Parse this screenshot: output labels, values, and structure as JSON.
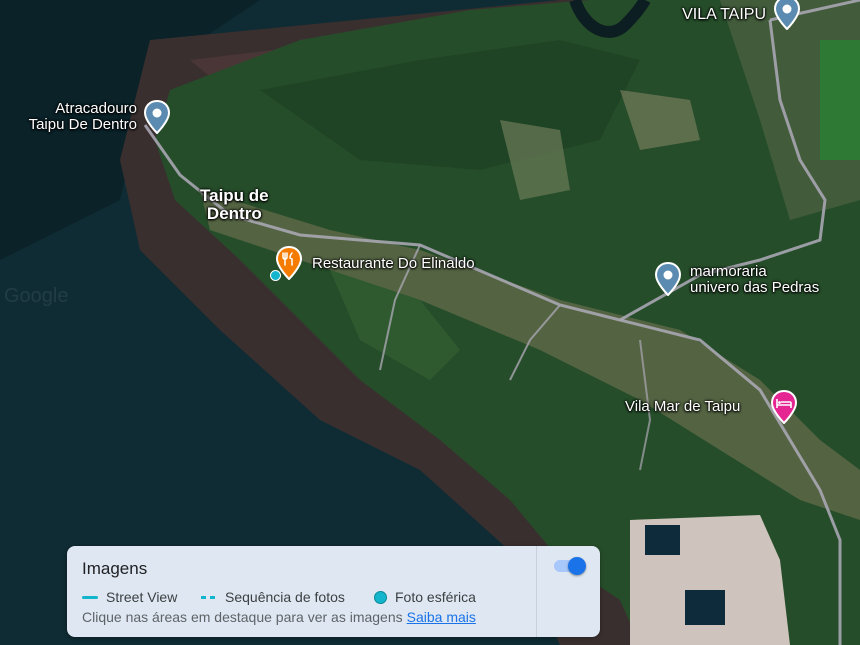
{
  "map": {
    "places": {
      "vila_taipu": "VILA TAIPU",
      "atracadouro": [
        "Atracadouro",
        "Taipu De Dentro"
      ],
      "taipu_de_dentro": [
        "Taipu de",
        "Dentro"
      ],
      "restaurante": "Restaurante Do Elinaldo",
      "marmoraria": [
        "marmoraria",
        "univero das Pedras"
      ],
      "vila_mar": "Vila Mar de Taipu"
    },
    "watermark": "Google"
  },
  "panel": {
    "title": "Imagens",
    "legend": {
      "street_view": "Street View",
      "photo_sequence": "Sequência de fotos",
      "spherical_photo": "Foto esférica"
    },
    "hint": "Clique nas áreas em destaque para ver as imagens",
    "learn_more": "Saiba mais",
    "toggle_on": true
  },
  "colors": {
    "street_view": "#12b5cb",
    "pin_blue": "#5b8bb0",
    "restaurant": "#f57c00",
    "hotel": "#e52592"
  }
}
